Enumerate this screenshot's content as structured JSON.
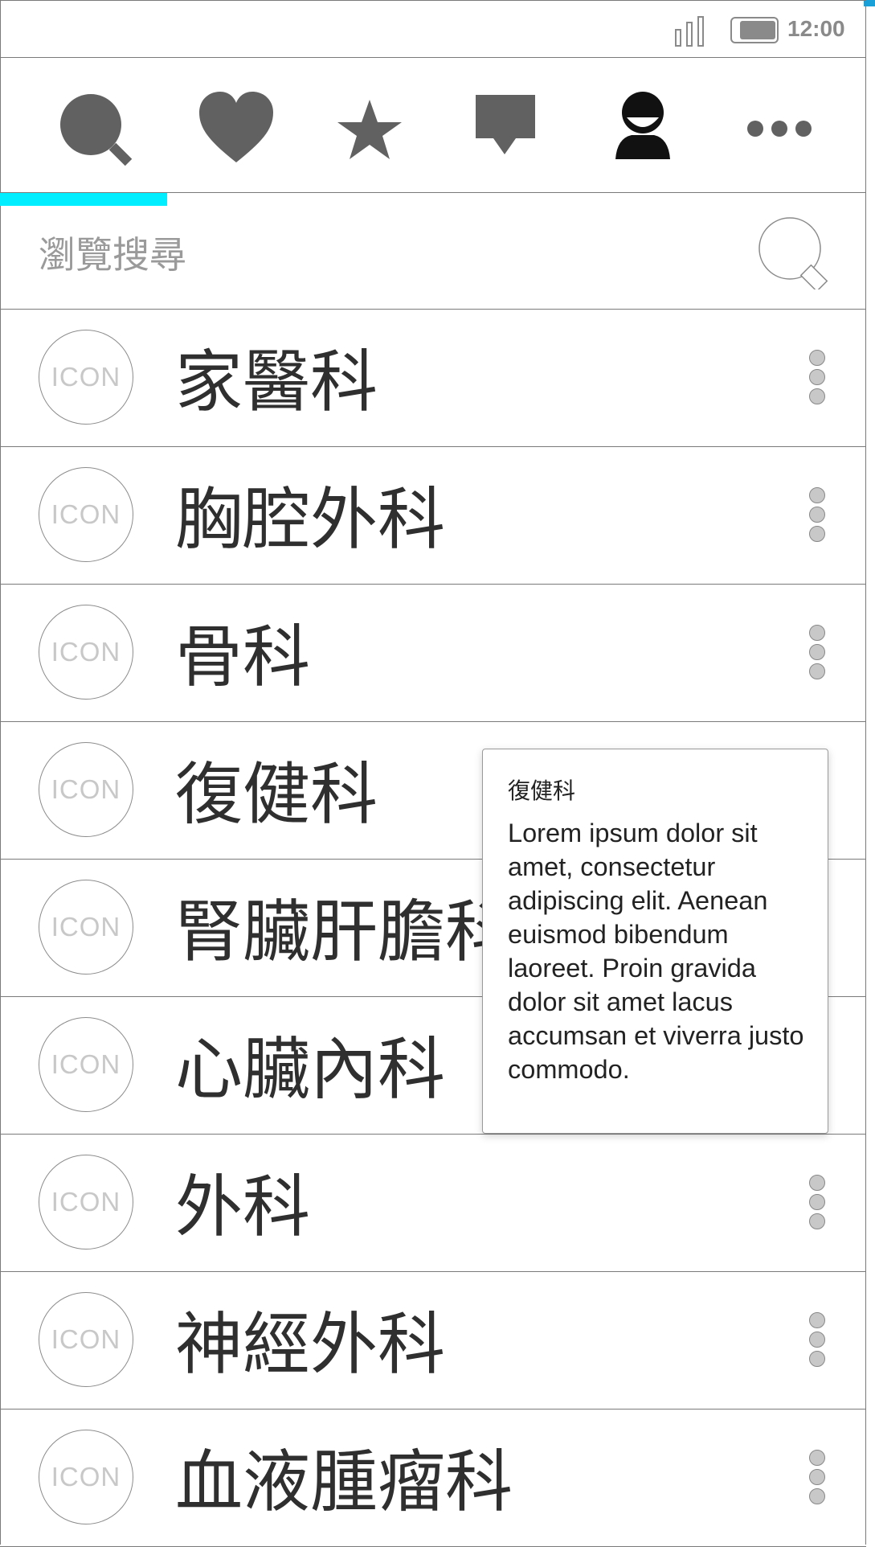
{
  "status_bar": {
    "time": "12:00",
    "icons": [
      "signal-icon",
      "battery-icon"
    ]
  },
  "toolbar": {
    "items": [
      {
        "name": "search",
        "icon": "search-icon"
      },
      {
        "name": "favorites",
        "icon": "heart-icon"
      },
      {
        "name": "starred",
        "icon": "star-icon"
      },
      {
        "name": "messages",
        "icon": "chat-bubble-icon"
      },
      {
        "name": "profile",
        "icon": "user-icon"
      },
      {
        "name": "more",
        "icon": "more-horizontal-icon"
      }
    ],
    "active_index": 0,
    "accent_color": "#00eeff",
    "icon_color": "#616161"
  },
  "search": {
    "placeholder": "瀏覽搜尋",
    "value": "",
    "icon": "search-icon"
  },
  "list": {
    "items": [
      {
        "icon_text": "ICON",
        "label": "家醫科"
      },
      {
        "icon_text": "ICON",
        "label": "胸腔外科"
      },
      {
        "icon_text": "ICON",
        "label": "骨科"
      },
      {
        "icon_text": "ICON",
        "label": "復健科"
      },
      {
        "icon_text": "ICON",
        "label": "腎臟肝膽科"
      },
      {
        "icon_text": "ICON",
        "label": "心臟內科"
      },
      {
        "icon_text": "ICON",
        "label": "外科"
      },
      {
        "icon_text": "ICON",
        "label": "神經外科"
      },
      {
        "icon_text": "ICON",
        "label": "血液腫瘤科"
      }
    ]
  },
  "popup": {
    "title": "復健科",
    "body": "Lorem ipsum dolor sit amet, consectetur adipiscing elit. Aenean euismod bibendum laoreet. Proin gravida dolor sit amet lacus accumsan et viverra justo commodo."
  }
}
